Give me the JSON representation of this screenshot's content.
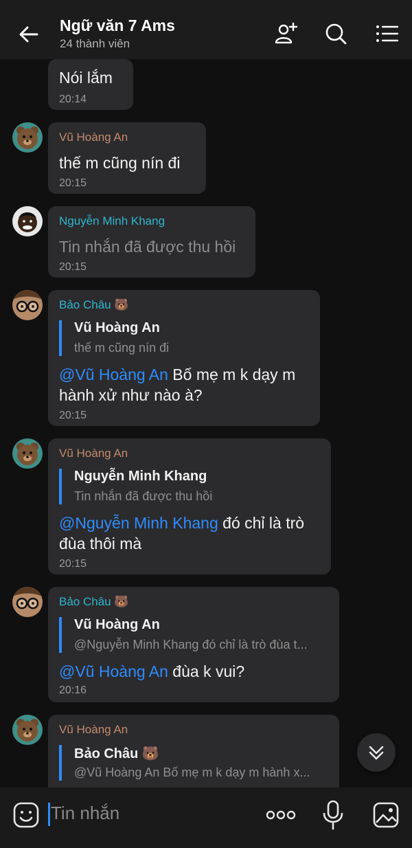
{
  "header": {
    "title": "Ngữ văn 7 Ams",
    "subtitle": "24 thành viên",
    "icons": [
      "back-arrow-icon",
      "add-member-icon",
      "search-icon",
      "menu-icon"
    ]
  },
  "messages": [
    {
      "text": "Nói lắm",
      "time": "20:14"
    },
    {
      "sender": "Vũ Hoàng An",
      "text": "thế m cũng nín đi",
      "time": "20:15"
    },
    {
      "sender": "Nguyễn Minh Khang",
      "text": "Tin nhắn đã được thu hồi",
      "time": "20:15"
    },
    {
      "sender": "Bảo Châu 🐻",
      "quote": {
        "name": "Vũ Hoàng An",
        "text": "thế m cũng nín đi"
      },
      "mention": "@Vũ Hoàng An",
      "text_line1": " Bố mẹ m k dạy m",
      "text_line2": "hành xử như nào à?",
      "time": "20:15"
    },
    {
      "sender": "Vũ Hoàng An",
      "quote": {
        "name": "Nguyễn Minh Khang",
        "text": "Tin nhắn đã được thu hồi"
      },
      "mention": "@Nguyễn Minh Khang",
      "text_line1": " đó chỉ là trò",
      "text_line2": "đùa thôi mà",
      "time": "20:15"
    },
    {
      "sender": "Bảo Châu 🐻",
      "quote": {
        "name": "Vũ Hoàng An",
        "text": "@Nguyễn Minh Khang đó chỉ là trò đùa t..."
      },
      "mention": "@Vũ Hoàng An",
      "text_line1": " đùa k vui?",
      "time": "20:16"
    },
    {
      "sender": "Vũ Hoàng An",
      "quote": {
        "name": "Bảo Châu 🐻",
        "text": "@Vũ Hoàng An Bố mẹ m k dạy m hành x..."
      }
    }
  ],
  "input": {
    "placeholder": "Tin nhắn"
  },
  "colors": {
    "accent": "#2f8cff",
    "bubble": "#2b2b2d",
    "background": "#101010",
    "sender_brown": "#c58a6e",
    "sender_cyan": "#2eb6cf"
  }
}
